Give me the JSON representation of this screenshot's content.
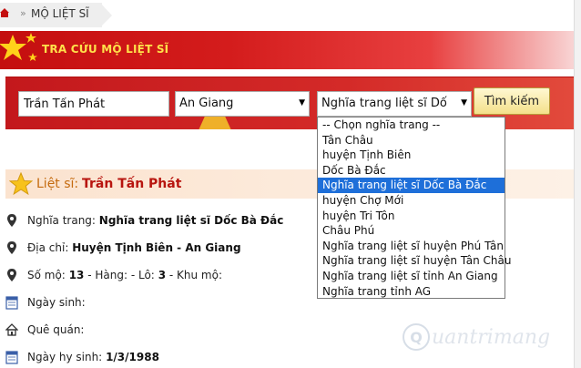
{
  "breadcrumb": {
    "separator": "»",
    "current": "MỘ LIỆT SĨ"
  },
  "banner": {
    "title": "TRA CỨU MỘ LIỆT SĨ"
  },
  "search": {
    "name_value": "Trần Tấn Phát",
    "province_value": "An Giang",
    "cemetery_value": "Nghĩa trang liệt sĩ Dố",
    "button_label": "Tìm kiếm",
    "caret": "▼"
  },
  "dropdown": {
    "options": [
      "-- Chọn nghĩa trang --",
      "Tân Châu",
      "huyện Tịnh Biên",
      "Dốc Bà Đắc",
      "Nghĩa trang liệt sĩ Dốc Bà Đắc",
      "huyện Chợ Mới",
      "huyện Tri Tôn",
      "Châu Phú",
      "Nghĩa trang liệt sĩ huyện Phú Tân",
      "Nghĩa trang liệt sĩ huyện Tân Châu",
      "Nghĩa trang liệt sĩ tỉnh An Giang",
      "Nghĩa trang tỉnh AG"
    ],
    "selected_index": 4
  },
  "result": {
    "label": "Liệt sĩ:",
    "name": "Trần Tấn Phát",
    "details": [
      {
        "icon": "map-pin-icon",
        "label": "Nghĩa trang:",
        "value": "Nghĩa trang liệt sĩ Dốc Bà Đắc"
      },
      {
        "icon": "map-pin-icon",
        "label": "Địa chỉ:",
        "value": "Huyện Tịnh Biên - An Giang"
      },
      {
        "icon": "map-pin-icon",
        "label": "Số mộ:",
        "value": "13",
        "extra1_label": "- Hàng:",
        "extra1_value": "- Lô:",
        "extra2_value": "3",
        "extra3_label": "- Khu mộ:"
      },
      {
        "icon": "calendar-icon",
        "label": "Ngày sinh:",
        "value": ""
      },
      {
        "icon": "house-icon",
        "label": "Quê quán:",
        "value": ""
      },
      {
        "icon": "calendar-icon",
        "label": "Ngày hy sinh:",
        "value": "1/3/1988"
      }
    ]
  },
  "watermark": {
    "letter": "Q",
    "text": "uantrimang"
  },
  "colors": {
    "banner_red": "#d41c1c",
    "title_yellow": "#ffe04a",
    "selected_blue": "#1e6fd9",
    "name_red": "#b8150f"
  }
}
